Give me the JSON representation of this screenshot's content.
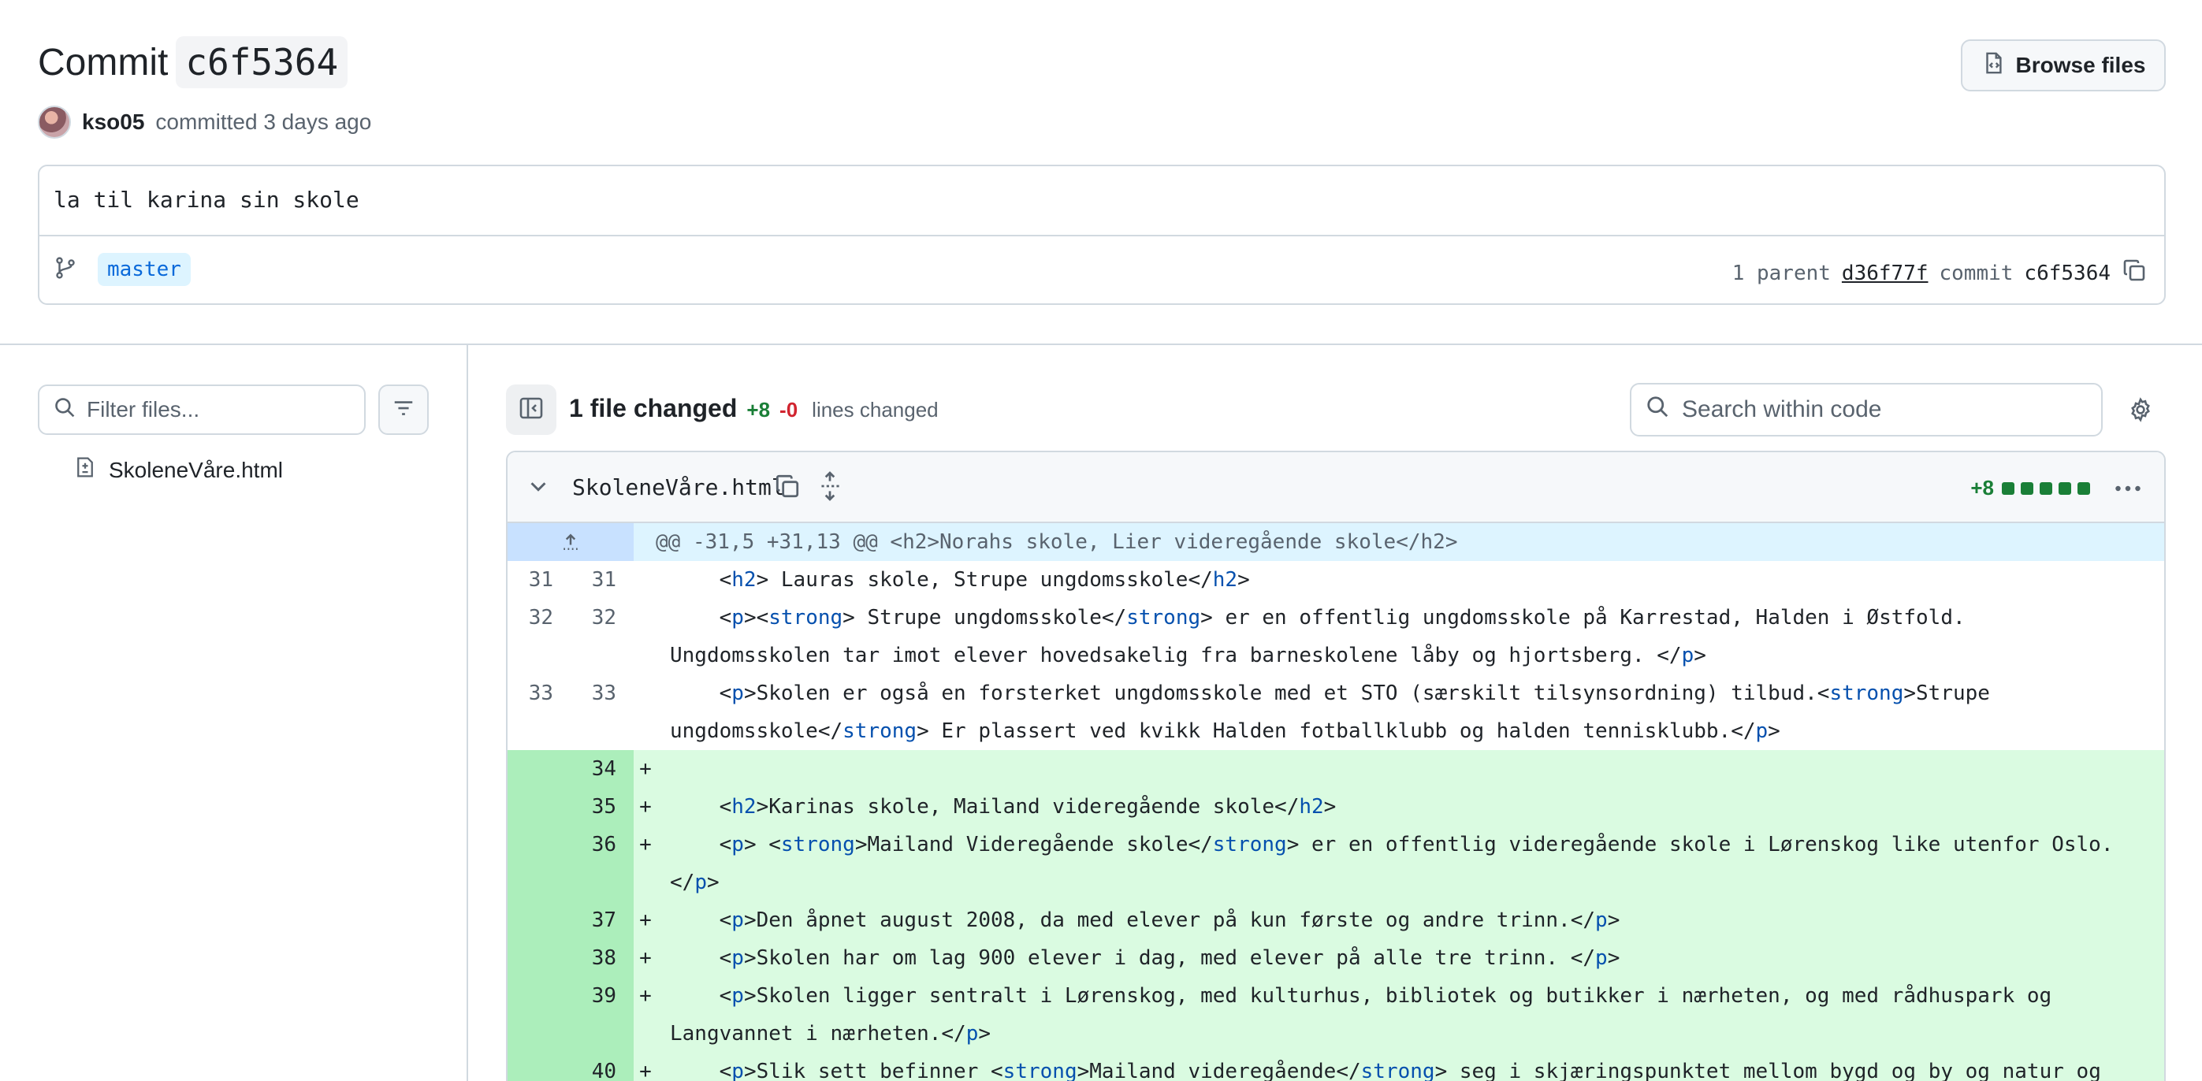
{
  "commit": {
    "title_prefix": "Commit",
    "sha": "c6f5364",
    "author": "kso05",
    "committed_text": "committed 3 days ago",
    "message": "la til karina sin skole",
    "branch": "master",
    "parent_label": "1 parent",
    "parent_sha": "d36f77f",
    "commit_label": "commit",
    "commit_sha": "c6f5364",
    "browse_label": "Browse files"
  },
  "sidebar": {
    "filter_placeholder": "Filter files...",
    "files": [
      "SkoleneVåre.html"
    ]
  },
  "toolbar": {
    "files_changed": "1 file changed",
    "additions": "+8",
    "deletions": "-0",
    "lines_changed": "lines changed",
    "search_placeholder": "Search within code"
  },
  "diff": {
    "filename": "SkoleneVåre.html",
    "additions": "+8",
    "hunk_header": "@@ -31,5 +31,13 @@ <h2>Norahs skole, Lier videregående skole</h2>",
    "lines": [
      {
        "type": "ctx",
        "old": "31",
        "new": "31",
        "text": "    <h2> Lauras skole, Strupe ungdomsskole</h2>"
      },
      {
        "type": "ctx",
        "old": "32",
        "new": "32",
        "text": "    <p><strong> Strupe ungdomsskole</strong> er en offentlig ungdomsskole på Karrestad, Halden i Østfold. Ungdomsskolen tar imot elever hovedsakelig fra barneskolene låby og hjortsberg. </p>"
      },
      {
        "type": "ctx",
        "old": "33",
        "new": "33",
        "text": "    <p>Skolen er også en forsterket ungdomsskole med et STO (særskilt tilsynsordning) tilbud.<strong>Strupe ungdomsskole</strong> Er plassert ved kvikk Halden fotballklubb og halden tennisklubb.</p>"
      },
      {
        "type": "add",
        "old": "",
        "new": "34",
        "text": ""
      },
      {
        "type": "add",
        "old": "",
        "new": "35",
        "text": "    <h2>Karinas skole, Mailand videregående skole</h2>"
      },
      {
        "type": "add",
        "old": "",
        "new": "36",
        "text": "    <p> <strong>Mailand Videregående skole</strong> er en offentlig videregående skole i Lørenskog like utenfor Oslo.</p>"
      },
      {
        "type": "add",
        "old": "",
        "new": "37",
        "text": "    <p>Den åpnet august 2008, da med elever på kun første og andre trinn.</p>"
      },
      {
        "type": "add",
        "old": "",
        "new": "38",
        "text": "    <p>Skolen har om lag 900 elever i dag, med elever på alle tre trinn. </p>"
      },
      {
        "type": "add",
        "old": "",
        "new": "39",
        "text": "    <p>Skolen ligger sentralt i Lørenskog, med kulturhus, bibliotek og butikker i nærheten, og med rådhuspark og Langvannet i nærheten.</p>"
      },
      {
        "type": "add",
        "old": "",
        "new": "40",
        "text": "    <p>Slik sett befinner <strong>Mailand videregående</strong> seg i skjæringspunktet mellom bygd og by og natur og kultur.</p>"
      }
    ]
  },
  "colors": {
    "add_bg": "#dafbe1",
    "add_gutter": "#aceebb",
    "hunk_bg": "#ddf4ff",
    "tag": "#0550ae",
    "accent_green": "#1a7f37",
    "accent_red": "#d1242f"
  }
}
